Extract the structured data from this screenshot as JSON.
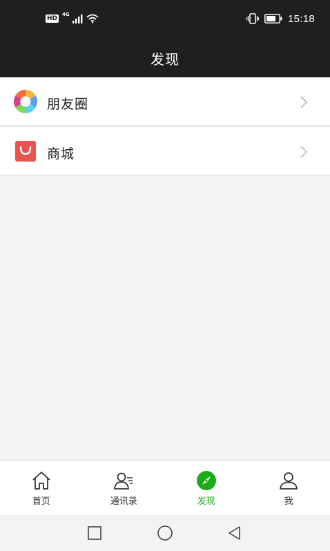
{
  "status_bar": {
    "hd": "HD",
    "network": "4G",
    "time": "15:18"
  },
  "header": {
    "title": "发现"
  },
  "menu": {
    "items": [
      {
        "label": "朋友圈",
        "icon": "moments-aperture-icon"
      },
      {
        "label": "商城",
        "icon": "shopping-bag-icon"
      }
    ]
  },
  "tabs": {
    "active": "发现",
    "accent_color": "#1aad19",
    "items": [
      {
        "label": "首页",
        "icon": "home-icon"
      },
      {
        "label": "通讯录",
        "icon": "contacts-icon"
      },
      {
        "label": "发现",
        "icon": "compass-icon"
      },
      {
        "label": "我",
        "icon": "profile-icon"
      }
    ]
  },
  "nav": {
    "buttons": [
      "recent-apps-icon",
      "home-circle-icon",
      "back-triangle-icon"
    ]
  }
}
